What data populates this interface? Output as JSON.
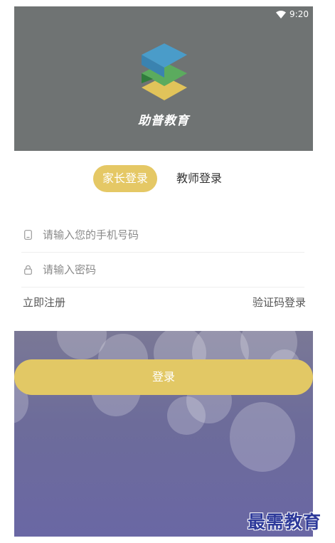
{
  "status_bar": {
    "time": "9:20",
    "icons": [
      "wifi-icon"
    ]
  },
  "header": {
    "brand": "助普教育",
    "logo": "stacked-layers-logo"
  },
  "tabs": [
    {
      "label": "家长登录",
      "active": true
    },
    {
      "label": "教师登录",
      "active": false
    }
  ],
  "form": {
    "phone": {
      "placeholder": "请输入您的手机号码",
      "value": "",
      "icon": "phone-icon"
    },
    "password": {
      "placeholder": "请输入密码",
      "value": "",
      "icon": "lock-icon"
    }
  },
  "links": {
    "register": "立即注册",
    "code_login": "验证码登录"
  },
  "login_button": "登录",
  "watermark": "最需教育",
  "colors": {
    "header_bg": "#6f7373",
    "accent": "#e2c865",
    "bottom_bg": "#6d6c9a",
    "watermark": "#2e3a9a"
  }
}
